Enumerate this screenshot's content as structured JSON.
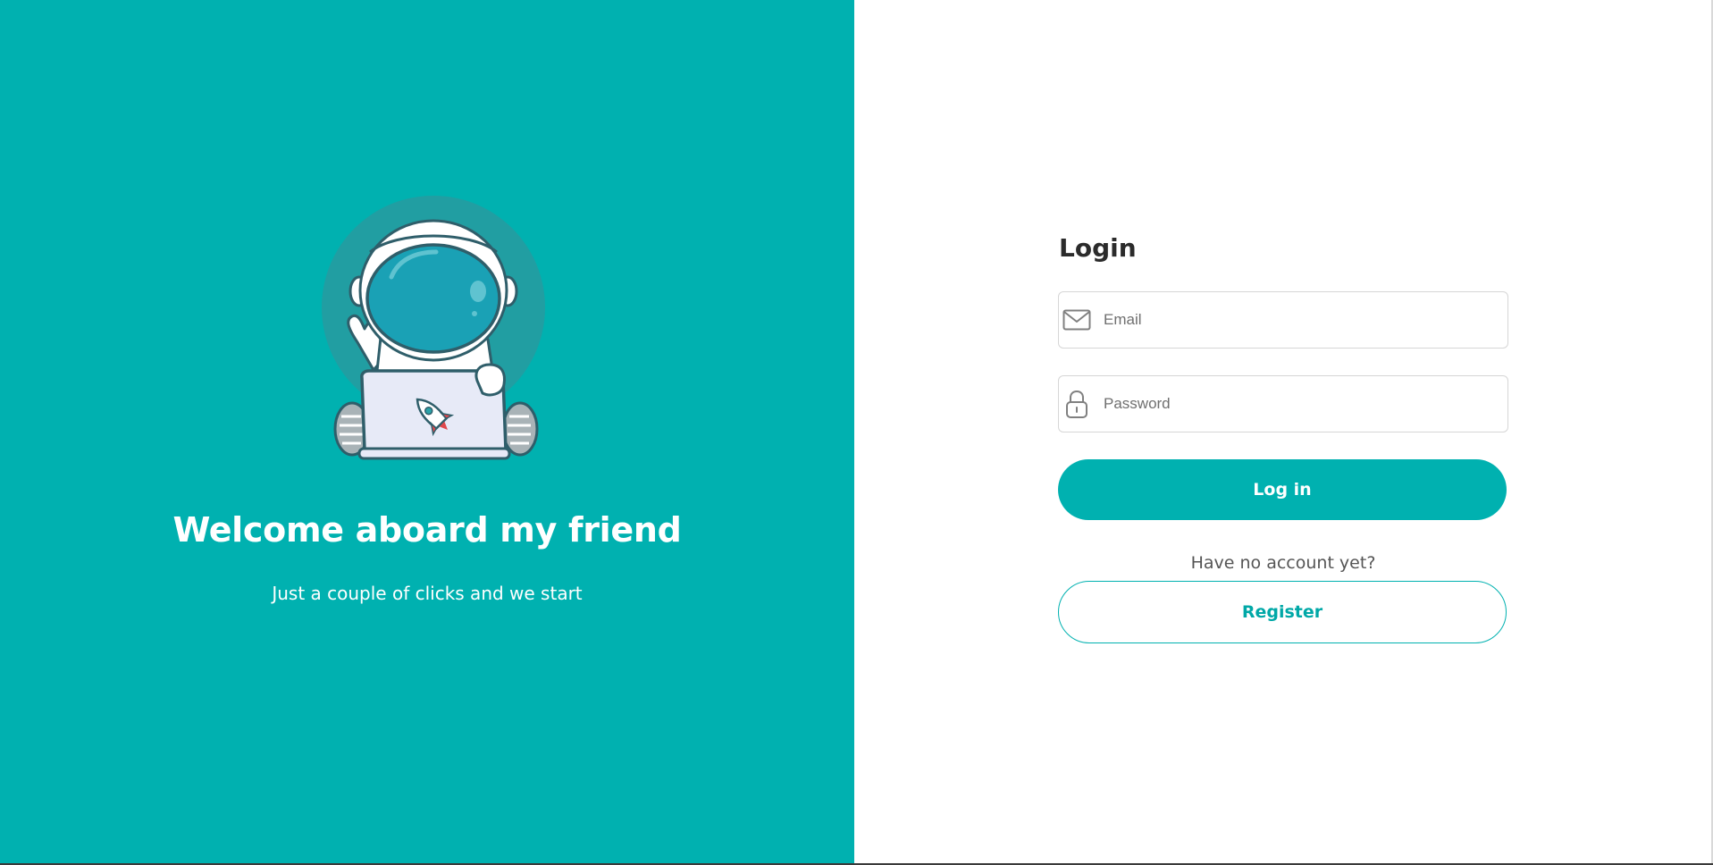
{
  "colors": {
    "brand": "#00b1b0",
    "background": "#ffffff",
    "heading": "#2b2b2b",
    "muted_text": "#555555"
  },
  "hero": {
    "illustration": "astronaut-with-laptop-illustration",
    "title": "Welcome aboard my friend",
    "subtitle": "Just a couple of clicks and we start"
  },
  "login": {
    "title": "Login",
    "email": {
      "icon": "envelope-icon",
      "placeholder": "Email",
      "value": ""
    },
    "password": {
      "icon": "lock-icon",
      "placeholder": "Password",
      "value": ""
    },
    "submit_label": "Log in",
    "no_account_text": "Have no account yet?",
    "register_label": "Register"
  }
}
